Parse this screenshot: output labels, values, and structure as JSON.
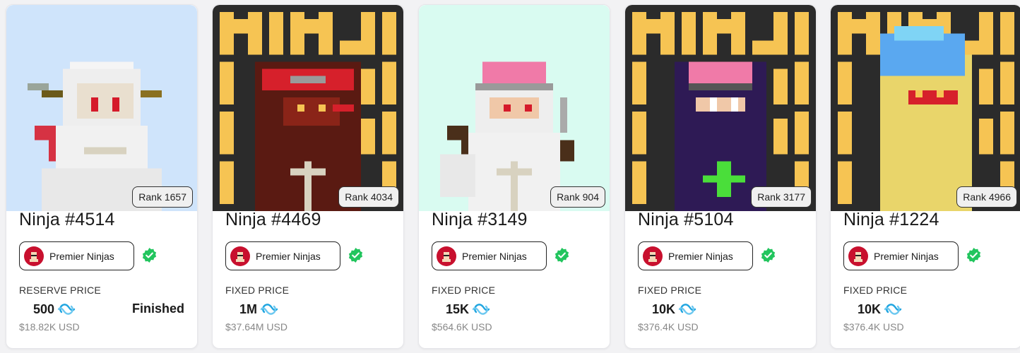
{
  "cards": [
    {
      "title": "Ninja #4514",
      "rank": "Rank 1657",
      "collection": "Premier Ninjas",
      "price_label": "RESERVE PRICE",
      "price": "500",
      "usd": "$18.82K USD",
      "status": "Finished",
      "background": "#cfe4fb",
      "art": "white-ninja-blue-bg"
    },
    {
      "title": "Ninja #4469",
      "rank": "Rank 4034",
      "collection": "Premier Ninjas",
      "price_label": "FIXED PRICE",
      "price": "1M",
      "usd": "$37.64M USD",
      "status": "",
      "background": "#2b2b2b",
      "art": "red-ninja-ninja-text-bg"
    },
    {
      "title": "Ninja #3149",
      "rank": "Rank 904",
      "collection": "Premier Ninjas",
      "price_label": "FIXED PRICE",
      "price": "15K",
      "usd": "$564.6K USD",
      "status": "",
      "background": "#d9fbf1",
      "art": "white-ninja-pink-hair"
    },
    {
      "title": "Ninja #5104",
      "rank": "Rank 3177",
      "collection": "Premier Ninjas",
      "price_label": "FIXED PRICE",
      "price": "10K",
      "usd": "$376.4K USD",
      "status": "",
      "background": "#2b2b2b",
      "art": "purple-ninja-ninja-text-bg"
    },
    {
      "title": "Ninja #1224",
      "rank": "Rank 4966",
      "collection": "Premier Ninjas",
      "price_label": "FIXED PRICE",
      "price": "10K",
      "usd": "$376.4K USD",
      "status": "",
      "background": "#2b2b2b",
      "art": "yellow-ninja-blue-hair-ninja-text-bg"
    }
  ],
  "colors": {
    "accent_gold": "#f6c453",
    "verified_green": "#22c55e",
    "coin_blue": "#1fa5e0",
    "avatar_red": "#c8102e"
  },
  "icons": {
    "verified": "verified-check-icon",
    "coin": "injective-coin-icon",
    "avatar": "premier-ninjas-avatar-icon"
  }
}
